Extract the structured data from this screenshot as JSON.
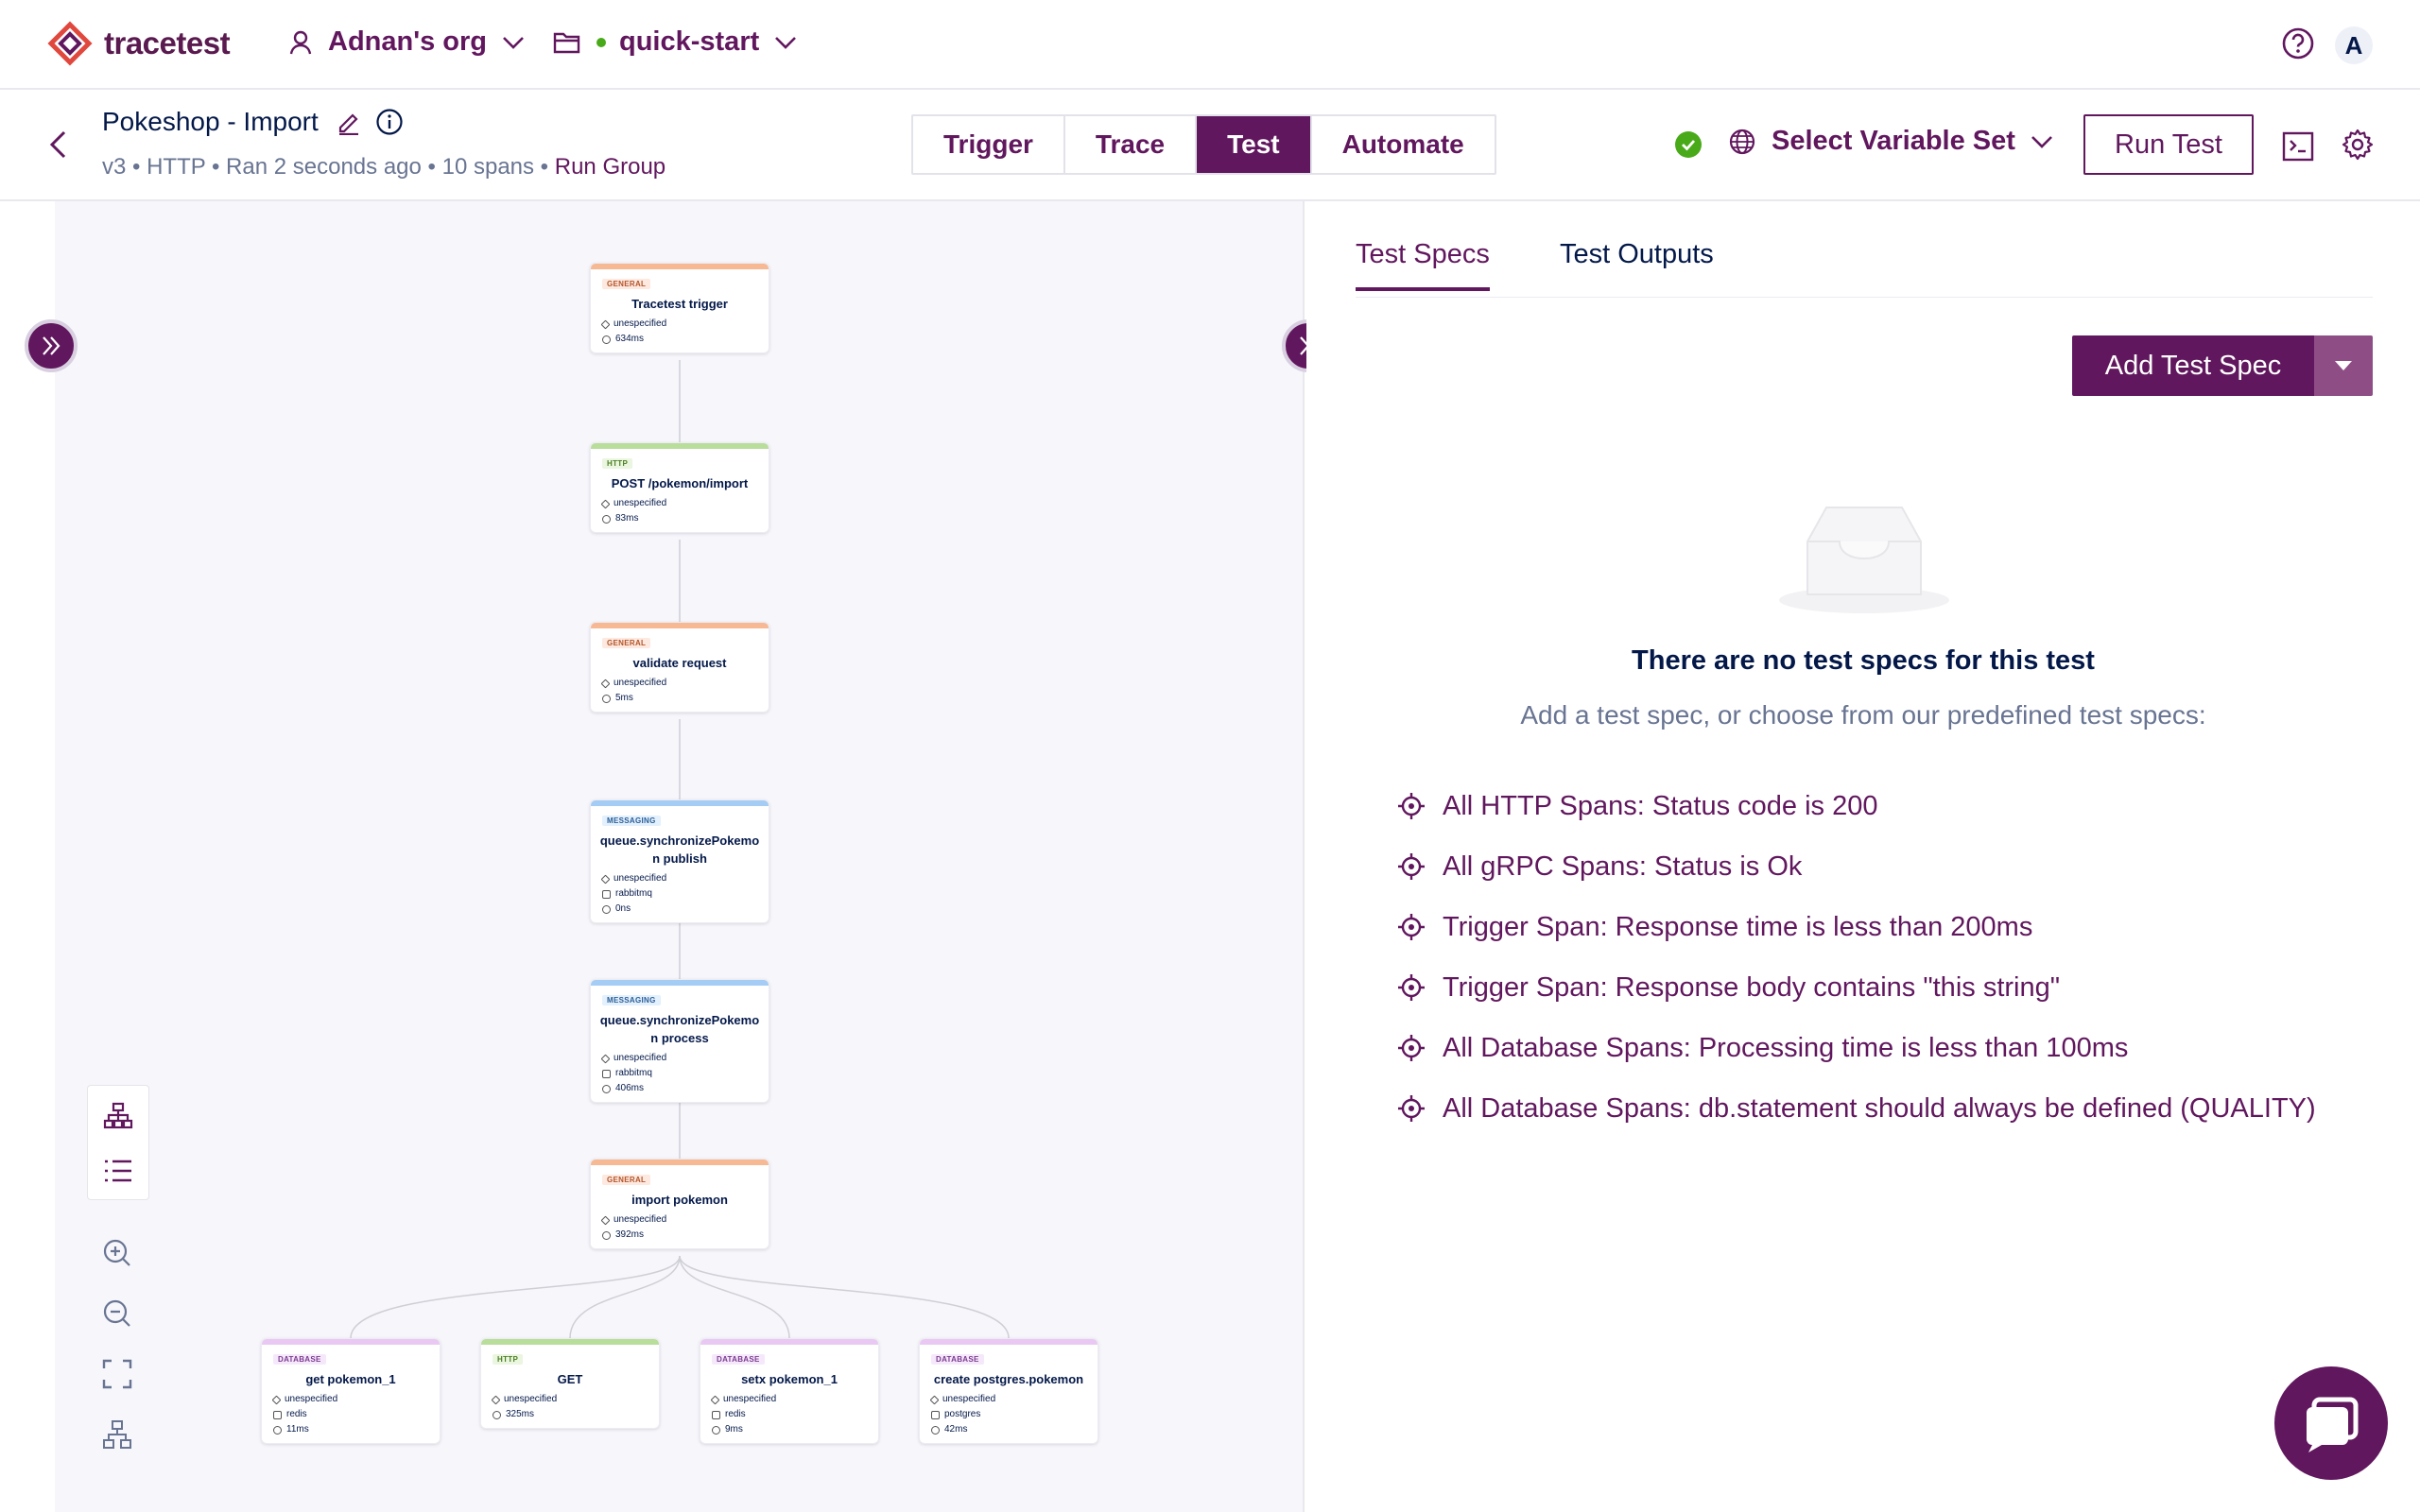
{
  "header": {
    "brand": "tracetest",
    "org_name": "Adnan's org",
    "env_name": "quick-start",
    "avatar_letter": "A"
  },
  "test": {
    "title": "Pokeshop - Import",
    "meta": "v3 • HTTP • Ran 2 seconds ago • 10 spans • ",
    "run_group": "Run Group"
  },
  "tabs": [
    {
      "label": "Trigger",
      "active": false
    },
    {
      "label": "Trace",
      "active": false
    },
    {
      "label": "Test",
      "active": true
    },
    {
      "label": "Automate",
      "active": false
    }
  ],
  "toolbar": {
    "variable_set": "Select Variable Set",
    "run_test": "Run Test"
  },
  "colors": {
    "brand": "#61175e",
    "general": "#f7b894",
    "http": "#b9dd9b",
    "messaging": "#a4ccf5",
    "database": "#e9c9f3",
    "success": "#49aa19"
  },
  "spans": [
    {
      "type": "GENERAL",
      "name": "Tracetest trigger",
      "system": "unespecified",
      "extra": "",
      "duration": "634ms"
    },
    {
      "type": "HTTP",
      "name": "POST /pokemon/import",
      "system": "unespecified",
      "extra": "",
      "duration": "83ms"
    },
    {
      "type": "GENERAL",
      "name": "validate request",
      "system": "unespecified",
      "extra": "",
      "duration": "5ms"
    },
    {
      "type": "MESSAGING",
      "name": "queue.synchronizePokemo n publish",
      "system": "unespecified",
      "extra": "rabbitmq",
      "duration": "0ns"
    },
    {
      "type": "MESSAGING",
      "name": "queue.synchronizePokemo n process",
      "system": "unespecified",
      "extra": "rabbitmq",
      "duration": "406ms"
    },
    {
      "type": "GENERAL",
      "name": "import pokemon",
      "system": "unespecified",
      "extra": "",
      "duration": "392ms"
    },
    {
      "type": "DATABASE",
      "name": "get pokemon_1",
      "system": "unespecified",
      "extra": "redis",
      "duration": "11ms"
    },
    {
      "type": "HTTP",
      "name": "GET",
      "system": "unespecified",
      "extra": "",
      "duration": "325ms"
    },
    {
      "type": "DATABASE",
      "name": "setx pokemon_1",
      "system": "unespecified",
      "extra": "redis",
      "duration": "9ms"
    },
    {
      "type": "DATABASE",
      "name": "create postgres.pokemon",
      "system": "unespecified",
      "extra": "postgres",
      "duration": "42ms"
    }
  ],
  "panel": {
    "tab_specs": "Test Specs",
    "tab_outputs": "Test Outputs",
    "add_spec": "Add Test Spec",
    "empty_title": "There are no test specs for this test",
    "empty_sub": "Add a test spec, or choose from our predefined test specs:",
    "predefined": [
      "All HTTP Spans: Status code is 200",
      "All gRPC Spans: Status is Ok",
      "Trigger Span: Response time is less than 200ms",
      "Trigger Span: Response body contains \"this string\"",
      "All Database Spans: Processing time is less than 100ms",
      "All Database Spans: db.statement should always be defined (QUALITY)"
    ]
  }
}
